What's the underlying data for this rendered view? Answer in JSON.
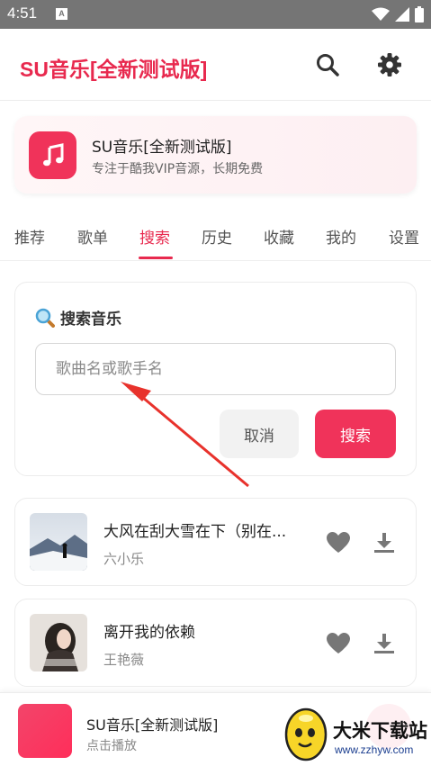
{
  "status_bar": {
    "time": "4:51",
    "notification_letter": "A"
  },
  "header": {
    "title": "SU音乐[全新测试版]",
    "search_icon": "search-icon",
    "settings_icon": "gear-icon"
  },
  "promo": {
    "title": "SU音乐[全新测试版]",
    "subtitle": "专注于酷我VIP音源，长期免费",
    "icon": "music-note-icon"
  },
  "tabs": [
    {
      "label": "推荐"
    },
    {
      "label": "歌单"
    },
    {
      "label": "搜索",
      "active": true
    },
    {
      "label": "历史"
    },
    {
      "label": "收藏"
    },
    {
      "label": "我的"
    },
    {
      "label": "设置"
    }
  ],
  "search": {
    "heading": "搜索音乐",
    "placeholder": "歌曲名或歌手名",
    "cancel_label": "取消",
    "search_label": "搜索"
  },
  "songs": [
    {
      "title": "大风在刮大雪在下（别在...",
      "artist": "六小乐"
    },
    {
      "title": "离开我的依赖",
      "artist": "王艳薇"
    }
  ],
  "player": {
    "title": "SU音乐[全新测试版]",
    "subtitle": "点击播放"
  },
  "watermark": {
    "text": "大米下载站",
    "url": "www.zzhyw.com"
  },
  "colors": {
    "accent": "#e8294e",
    "button": "#f0335a"
  }
}
